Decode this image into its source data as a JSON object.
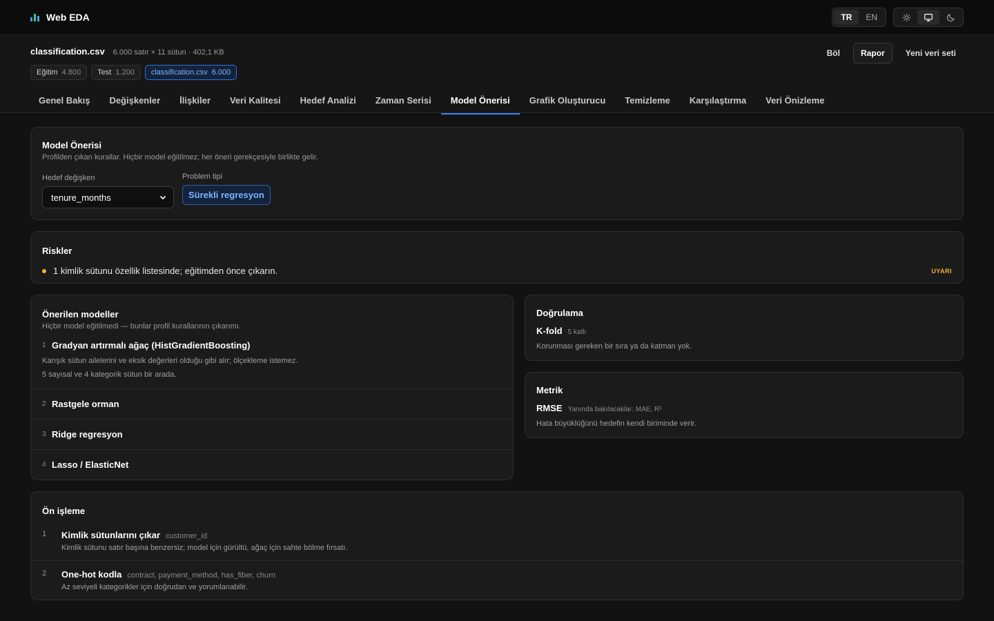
{
  "app": {
    "title": "Web EDA"
  },
  "lang": {
    "tr": "TR",
    "en": "EN"
  },
  "theme_icons": [
    "sun-icon",
    "monitor-icon",
    "moon-icon"
  ],
  "file": {
    "name": "classification.csv",
    "meta": "6.000 satır × 11 sütun · 402,1 KB",
    "actions": {
      "split": "Böl",
      "report": "Rapor",
      "new_dataset": "Yeni veri seti"
    },
    "chips": [
      {
        "label": "Eğitim",
        "count": "4.800"
      },
      {
        "label": "Test",
        "count": "1.200"
      },
      {
        "label": "classification.csv",
        "count": "6.000"
      }
    ]
  },
  "tabs": [
    "Genel Bakış",
    "Değişkenler",
    "İlişkiler",
    "Veri Kalitesi",
    "Hedef Analizi",
    "Zaman Serisi",
    "Model Önerisi",
    "Grafik Oluşturucu",
    "Temizleme",
    "Karşılaştırma",
    "Veri Önizleme"
  ],
  "active_tab": "Model Önerisi",
  "suggestion": {
    "title": "Model Önerisi",
    "subtitle": "Profilden çıkan kurallar. Hiçbir model eğitilmez; her öneri gerekçesiyle birlikte gelir.",
    "target_label": "Hedef değişken",
    "target_value": "tenure_months",
    "problem_label": "Problem tipi",
    "problem_value": "Sürekli regresyon"
  },
  "risks": {
    "title": "Riskler",
    "items": [
      {
        "text": "1 kimlik sütunu özellik listesinde; eğitimden önce çıkarın.",
        "level": "UYARI"
      }
    ]
  },
  "models": {
    "title": "Önerilen modeller",
    "subtitle": "Hiçbir model eğitilmedi — bunlar profil kurallarının çıkarımı.",
    "items": [
      {
        "idx": "1",
        "name": "Gradyan artırmalı ağaç (HistGradientBoosting)",
        "desc": "Karışık sütun ailelerini ve eksik değerleri olduğu gibi alır; ölçekleme istemez.",
        "desc2": "5 sayısal ve 4 kategorik sütun bir arada."
      },
      {
        "idx": "2",
        "name": "Rastgele orman"
      },
      {
        "idx": "3",
        "name": "Ridge regresyon"
      },
      {
        "idx": "4",
        "name": "Lasso / ElasticNet"
      }
    ]
  },
  "validation": {
    "title": "Doğrulama",
    "key": "K-fold",
    "sub": "5 katlı",
    "desc": "Korunması gereken bir sıra ya da katman yok."
  },
  "metric": {
    "title": "Metrik",
    "key": "RMSE",
    "sub": "Yanında bakılacaklar: MAE, R²",
    "desc": "Hata büyüklüğünü hedefin kendi biriminde verir."
  },
  "preprocessing": {
    "title": "Ön işleme",
    "items": [
      {
        "idx": "1",
        "name": "Kimlik sütunlarını çıkar",
        "cols": "customer_id",
        "desc": "Kimlik sütunu satır başına benzersiz; model için gürültü, ağaç için sahte bölme fırsatı."
      },
      {
        "idx": "2",
        "name": "One-hot kodla",
        "cols": "contract, payment_method, has_fiber, churn",
        "desc": "Az seviyeli kategorikler için doğrudan ve yorumlanabilir."
      }
    ]
  },
  "colors": {
    "accent": "#3a82f0",
    "warning": "#f2b233",
    "background": "#121212"
  }
}
